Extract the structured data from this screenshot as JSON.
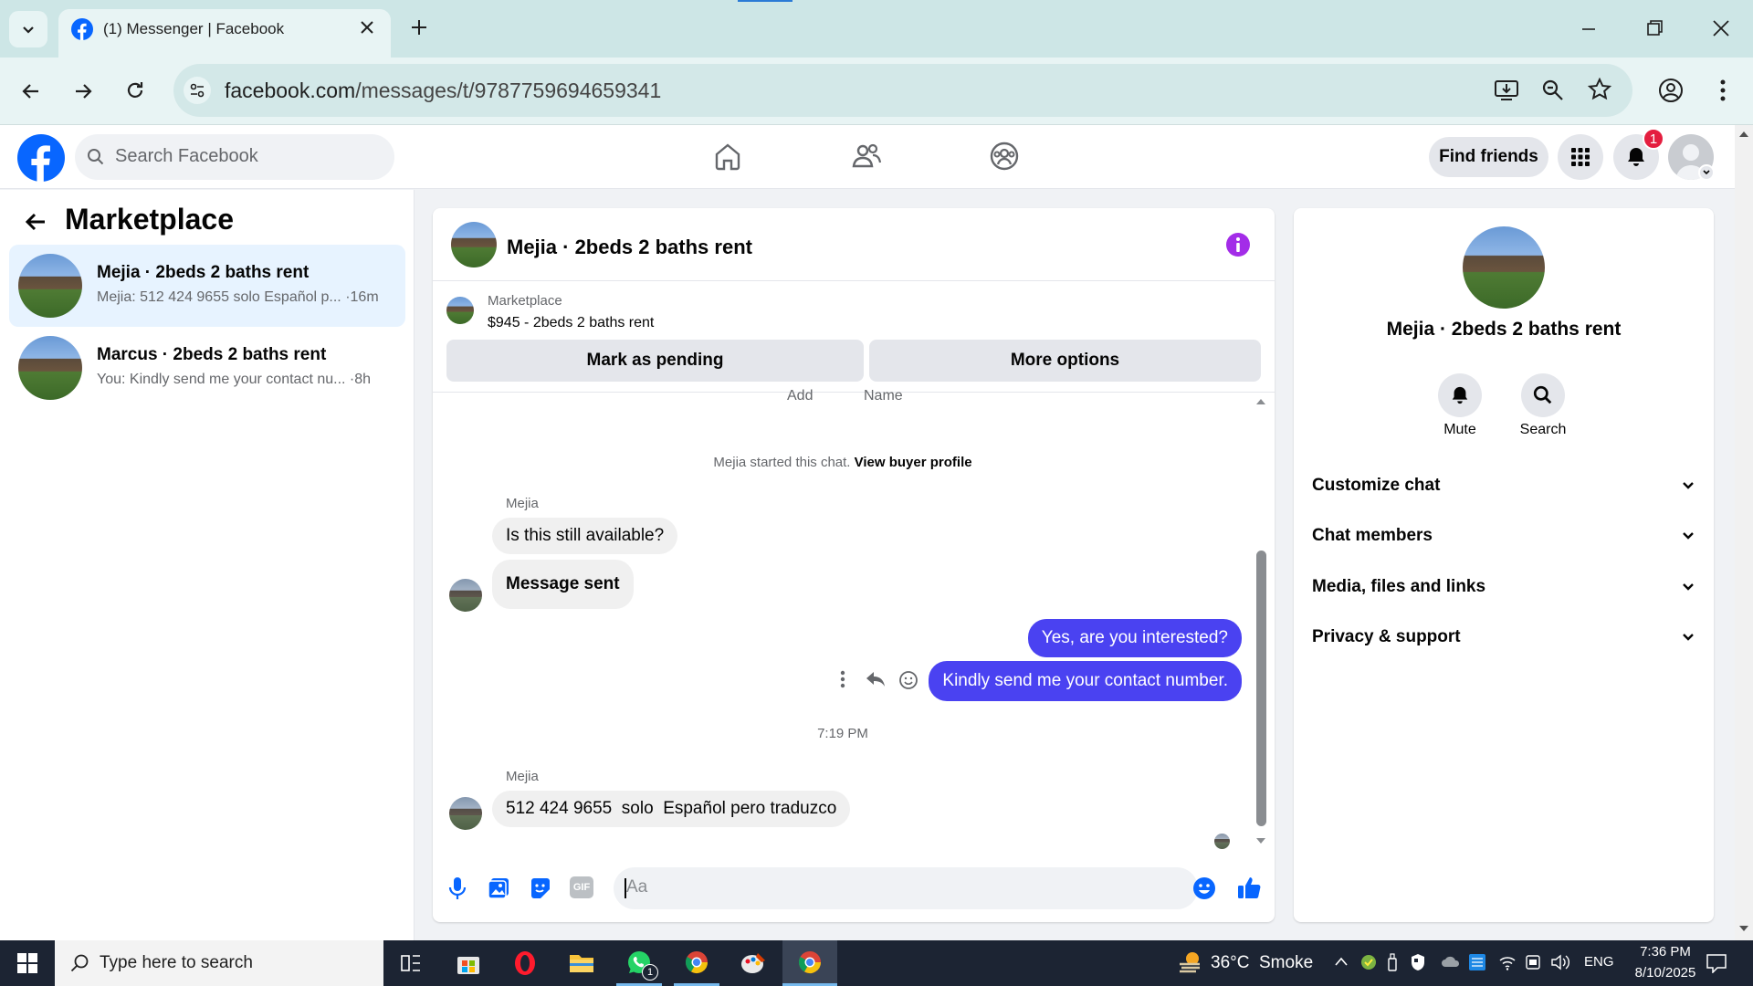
{
  "browser": {
    "tab_title": "(1) Messenger | Facebook",
    "url_domain": "facebook.com",
    "url_path": "/messages/t/9787759694659341"
  },
  "fb_header": {
    "search_placeholder": "Search Facebook",
    "find_friends_label": "Find friends",
    "notification_count": "1"
  },
  "left_pane": {
    "title": "Marketplace",
    "conversations": [
      {
        "name": "Mejia · 2beds 2 baths rent",
        "preview": "Mejia: 512 424 9655 solo Español p...",
        "time": "·16m",
        "active": true
      },
      {
        "name": "Marcus · 2beds 2 baths rent",
        "preview": "You: Kindly send me your contact nu...",
        "time": "·8h",
        "active": false
      }
    ]
  },
  "chat": {
    "title": "Mejia · 2beds 2 baths rent",
    "listing_source": "Marketplace",
    "listing_price": "$945 - 2beds 2 baths rent",
    "mark_pending_label": "Mark as pending",
    "more_options_label": "More options",
    "cut_off_labels": [
      "Add",
      "Name"
    ],
    "started_text": "Mejia started this chat.",
    "view_buyer_link": "View buyer profile",
    "messages": [
      {
        "sender": "Mejia",
        "text": "Is this still available?",
        "direction": "in"
      },
      {
        "text": "Message sent",
        "direction": "in"
      },
      {
        "text": "Yes, are you interested?",
        "direction": "out"
      },
      {
        "text": "Kindly send me your contact number.",
        "direction": "out"
      },
      {
        "timestamp": "7:19 PM"
      },
      {
        "sender": "Mejia",
        "text": "512 424 9655  solo  Español pero traduzco",
        "direction": "in"
      }
    ],
    "composer_placeholder": "Aa"
  },
  "right_pane": {
    "name": "Mejia · 2beds 2 baths rent",
    "mute_label": "Mute",
    "search_label": "Search",
    "sections": [
      "Customize chat",
      "Chat members",
      "Media, files and links",
      "Privacy & support"
    ]
  },
  "taskbar": {
    "search_placeholder": "Type here to search",
    "whatsapp_badge": "1",
    "weather": "36°C  Smoke",
    "language": "ENG",
    "time": "7:36 PM",
    "date": "8/10/2025"
  },
  "colors": {
    "messenger_blue": "#4a42f1",
    "fb_blue": "#0866ff",
    "chrome_bg": "#cde6e6"
  }
}
